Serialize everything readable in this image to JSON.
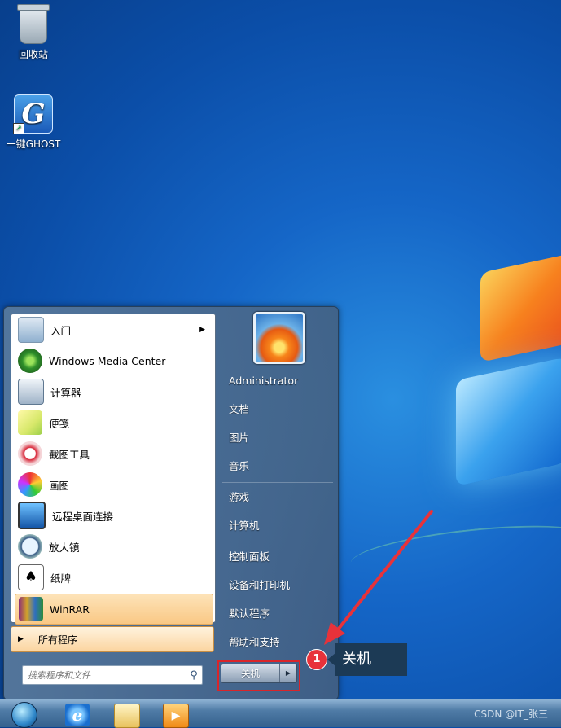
{
  "desktop": {
    "icons": [
      {
        "label": "回收站",
        "icon": "recycle-bin-icon"
      },
      {
        "label": "一键GHOST",
        "icon": "ghost-icon"
      }
    ]
  },
  "start_menu": {
    "programs": [
      {
        "label": "入门",
        "icon": "getting-started-icon",
        "has_submenu": true
      },
      {
        "label": "Windows Media Center",
        "icon": "media-center-icon"
      },
      {
        "label": "计算器",
        "icon": "calculator-icon"
      },
      {
        "label": "便笺",
        "icon": "sticky-notes-icon"
      },
      {
        "label": "截图工具",
        "icon": "snipping-tool-icon"
      },
      {
        "label": "画图",
        "icon": "paint-icon"
      },
      {
        "label": "远程桌面连接",
        "icon": "remote-desktop-icon"
      },
      {
        "label": "放大镜",
        "icon": "magnifier-icon"
      },
      {
        "label": "纸牌",
        "icon": "solitaire-icon"
      },
      {
        "label": "WinRAR",
        "icon": "winrar-icon",
        "highlighted": true
      }
    ],
    "all_programs": "所有程序",
    "search_placeholder": "搜索程序和文件",
    "user": "Administrator",
    "right_items": [
      "文档",
      "图片",
      "音乐",
      "游戏",
      "计算机",
      "控制面板",
      "设备和打印机",
      "默认程序",
      "帮助和支持"
    ],
    "shutdown_label": "关机"
  },
  "annotation": {
    "step": "1",
    "label": "关机",
    "color": "#e8323a"
  },
  "watermark": "CSDN @IT_张三"
}
